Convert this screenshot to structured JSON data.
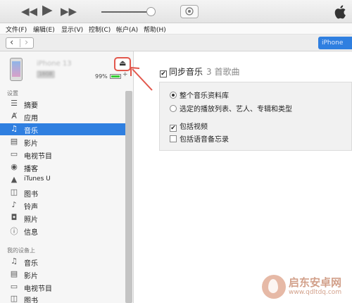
{
  "menu": [
    {
      "label": "文件(F)"
    },
    {
      "label": "编辑(E)"
    },
    {
      "label": "显示(V)"
    },
    {
      "label": "控制(C)"
    },
    {
      "label": "帐户(A)"
    },
    {
      "label": "帮助(H)"
    }
  ],
  "nav": {
    "device_button": "iPhone"
  },
  "device": {
    "name": "iPhone 13",
    "capacity": "16GB",
    "battery": "99%",
    "battery_level": 0.99
  },
  "sidebar": {
    "settings_label": "设置",
    "settings_items": [
      {
        "label": "摘要",
        "icon": "summary-icon",
        "selected": false
      },
      {
        "label": "应用",
        "icon": "apps-icon",
        "selected": false
      },
      {
        "label": "音乐",
        "icon": "music-note-icon",
        "selected": true
      },
      {
        "label": "影片",
        "icon": "film-icon",
        "selected": false
      },
      {
        "label": "电视节目",
        "icon": "tv-icon",
        "selected": false
      },
      {
        "label": "播客",
        "icon": "podcast-icon",
        "selected": false
      },
      {
        "label": "iTunes U",
        "icon": "graduation-cap-icon",
        "selected": false
      },
      {
        "label": "图书",
        "icon": "book-icon",
        "selected": false
      },
      {
        "label": "铃声",
        "icon": "bell-icon",
        "selected": false
      },
      {
        "label": "照片",
        "icon": "camera-icon",
        "selected": false
      },
      {
        "label": "信息",
        "icon": "info-icon",
        "selected": false
      }
    ],
    "mydevice_label": "我的设备上",
    "mydevice_items": [
      {
        "label": "音乐",
        "icon": "music-note-icon"
      },
      {
        "label": "影片",
        "icon": "film-icon"
      },
      {
        "label": "电视节目",
        "icon": "tv-icon"
      },
      {
        "label": "图书",
        "icon": "book-icon"
      }
    ]
  },
  "main": {
    "sync_title": "同步音乐",
    "sync_count": "3 首歌曲",
    "option_all": "整个音乐资料库",
    "option_selected": "选定的播放列表、艺人、专辑和类型",
    "include_video": "包括视频",
    "include_voice_memos": "包括语音备忘录"
  },
  "watermark": {
    "name": "启东安卓网",
    "url": "www.qdltdq.com"
  },
  "colors": {
    "accent": "#2f7fe0",
    "annotation": "#e2574c"
  }
}
